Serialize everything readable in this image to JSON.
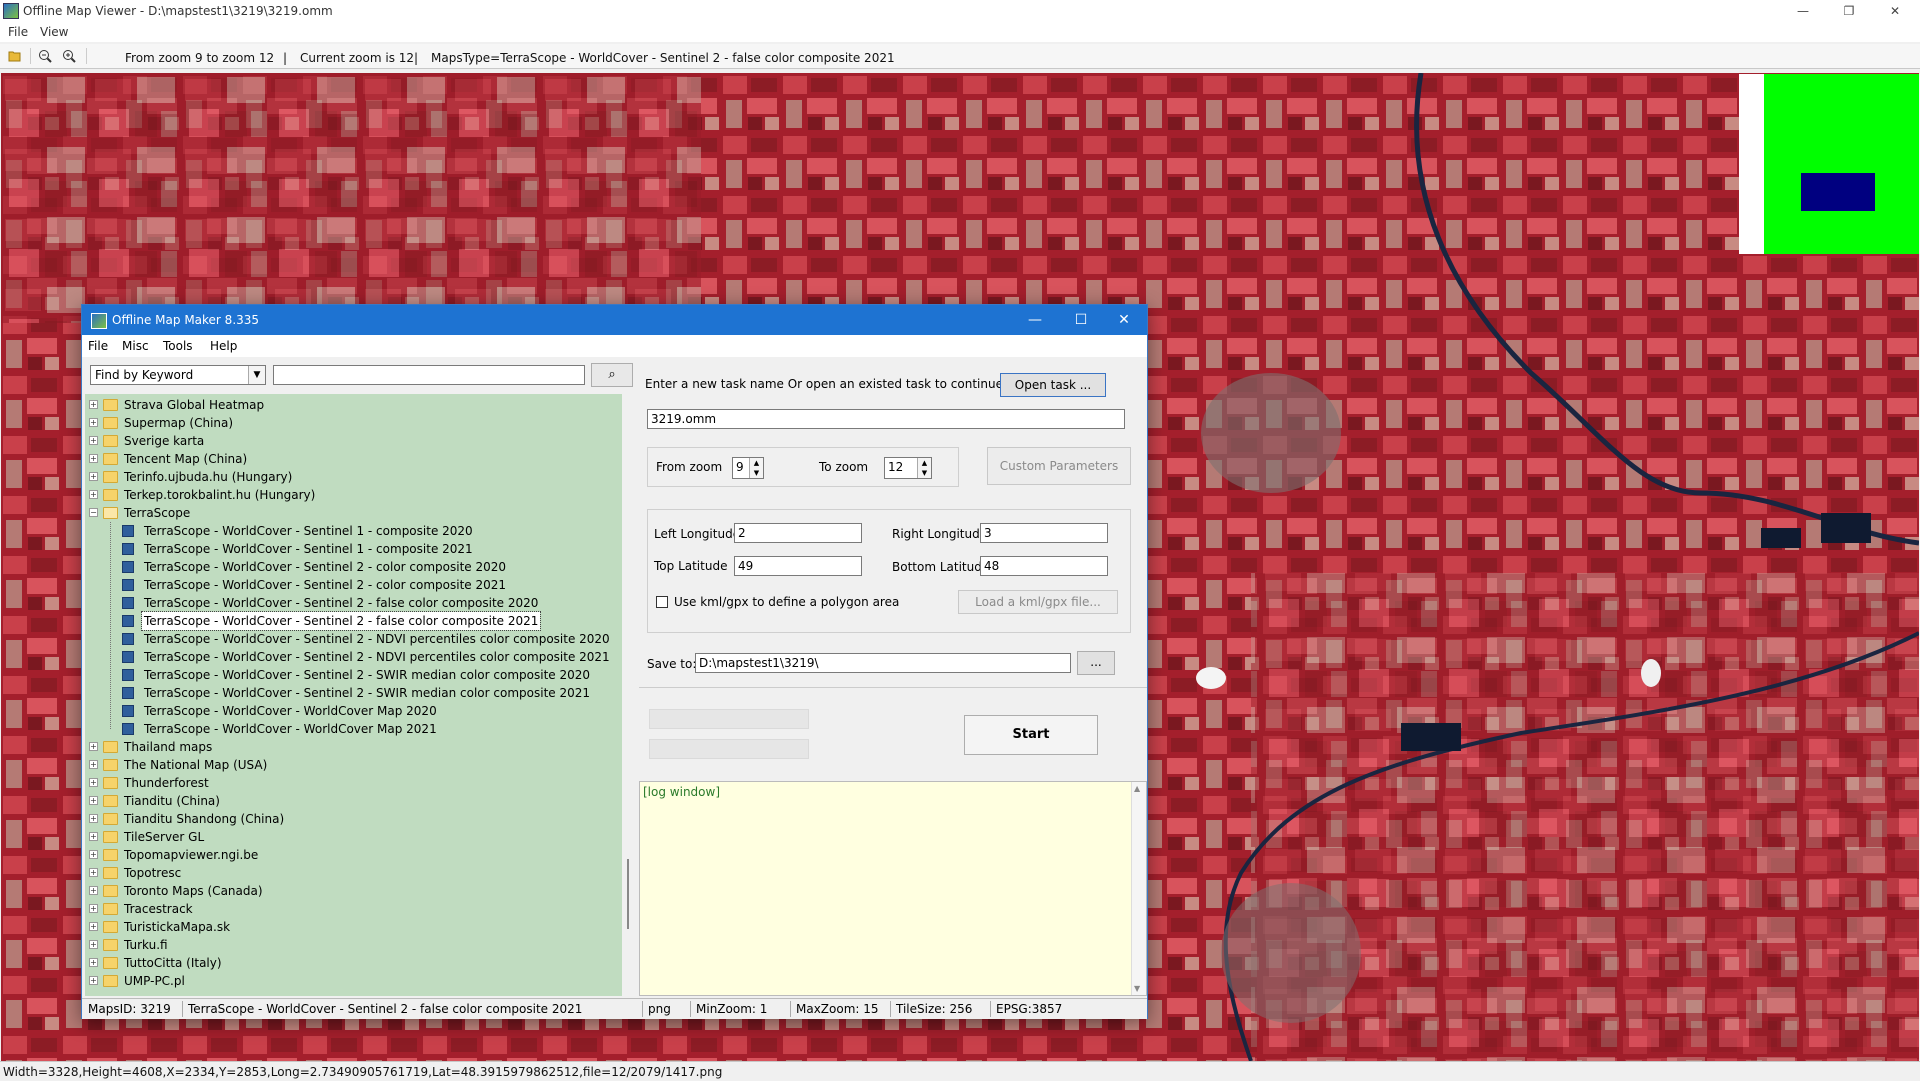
{
  "window": {
    "title": "Offline Map Viewer - D:\\mapstest1\\3219\\3219.omm",
    "controls": {
      "minimize": "—",
      "maximize": "❐",
      "close": "✕"
    }
  },
  "menu": [
    "File",
    "View"
  ],
  "toolbar": {
    "icons": [
      "open-folder-icon",
      "zoom-out-icon",
      "zoom-in-icon"
    ],
    "zoom_range": "From zoom 9 to zoom 12",
    "separator": "|",
    "current_zoom": "Current zoom is 12",
    "maps_type": "MapsType=TerraScope - WorldCover - Sentinel 2 - false color composite 2021"
  },
  "status_bar": "Width=3328,Height=4608,X=2334,Y=2853,Long=2.73490905761719,Lat=48.3915979862512,file=12/2079/1417.png",
  "minimap_colors": {
    "area": "#00ff00",
    "view": "#000080"
  },
  "dialog": {
    "title": "Offline Map Maker 8.335",
    "menu": [
      "File",
      "Misc",
      "Tools",
      "Help"
    ],
    "find_select": "Find by Keyword",
    "search_value": "",
    "tree": [
      {
        "label": "Strava Global Heatmap",
        "type": "folder",
        "expanded": false
      },
      {
        "label": "Supermap (China)",
        "type": "folder",
        "expanded": false
      },
      {
        "label": "Sverige karta",
        "type": "folder",
        "expanded": false
      },
      {
        "label": "Tencent Map (China)",
        "type": "folder",
        "expanded": false
      },
      {
        "label": "Terinfo.ujbuda.hu (Hungary)",
        "type": "folder",
        "expanded": false
      },
      {
        "label": "Terkep.torokbalint.hu (Hungary)",
        "type": "folder",
        "expanded": false
      },
      {
        "label": "TerraScope",
        "type": "folder",
        "expanded": true
      },
      {
        "label": "TerraScope - WorldCover - Sentinel 1 - composite 2020",
        "type": "map"
      },
      {
        "label": "TerraScope - WorldCover - Sentinel 1 - composite 2021",
        "type": "map"
      },
      {
        "label": "TerraScope - WorldCover - Sentinel 2 - color composite 2020",
        "type": "map"
      },
      {
        "label": "TerraScope - WorldCover - Sentinel 2 - color composite 2021",
        "type": "map"
      },
      {
        "label": "TerraScope - WorldCover - Sentinel 2 - false color composite 2020",
        "type": "map"
      },
      {
        "label": "TerraScope - WorldCover - Sentinel 2 - false color composite 2021",
        "type": "map",
        "selected": true
      },
      {
        "label": "TerraScope - WorldCover - Sentinel 2 - NDVI percentiles color composite 2020",
        "type": "map"
      },
      {
        "label": "TerraScope - WorldCover - Sentinel 2 - NDVI percentiles color composite 2021",
        "type": "map"
      },
      {
        "label": "TerraScope - WorldCover - Sentinel 2 - SWIR median color composite 2020",
        "type": "map"
      },
      {
        "label": "TerraScope - WorldCover - Sentinel 2 - SWIR median color composite 2021",
        "type": "map"
      },
      {
        "label": "TerraScope - WorldCover - WorldCover Map 2020",
        "type": "map"
      },
      {
        "label": "TerraScope - WorldCover - WorldCover Map 2021",
        "type": "map"
      },
      {
        "label": "Thailand maps",
        "type": "folder",
        "expanded": false
      },
      {
        "label": "The National Map (USA)",
        "type": "folder",
        "expanded": false
      },
      {
        "label": "Thunderforest",
        "type": "folder",
        "expanded": false
      },
      {
        "label": "Tianditu (China)",
        "type": "folder",
        "expanded": false
      },
      {
        "label": "Tianditu Shandong (China)",
        "type": "folder",
        "expanded": false
      },
      {
        "label": "TileServer GL",
        "type": "folder",
        "expanded": false
      },
      {
        "label": "Topomapviewer.ngi.be",
        "type": "folder",
        "expanded": false
      },
      {
        "label": "Topotresc",
        "type": "folder",
        "expanded": false
      },
      {
        "label": "Toronto Maps (Canada)",
        "type": "folder",
        "expanded": false
      },
      {
        "label": "Tracestrack",
        "type": "folder",
        "expanded": false
      },
      {
        "label": "TuristickaMapa.sk",
        "type": "folder",
        "expanded": false
      },
      {
        "label": "Turku.fi",
        "type": "folder",
        "expanded": false
      },
      {
        "label": "TuttoCitta (Italy)",
        "type": "folder",
        "expanded": false
      },
      {
        "label": "UMP-PC.pl",
        "type": "folder",
        "expanded": false
      }
    ],
    "task": {
      "prompt": "Enter a new task name Or open an existed task to continue:",
      "open_button": "Open task ...",
      "name": "3219.omm"
    },
    "zoom": {
      "from_label": "From zoom",
      "from_value": "9",
      "to_label": "To zoom",
      "to_value": "12",
      "custom_button": "Custom Parameters"
    },
    "bounds": {
      "left_label": "Left Longitude",
      "left_value": "2",
      "right_label": "Right Longitude",
      "right_value": "3",
      "top_label": "Top Latitude",
      "top_value": "49",
      "bottom_label": "Bottom Latitude",
      "bottom_value": "48",
      "kml_checkbox_label": "Use kml/gpx to define a polygon area",
      "kml_button": "Load a kml/gpx file..."
    },
    "save": {
      "label": "Save to:",
      "path": "D:\\mapstest1\\3219\\",
      "browse_button": "..."
    },
    "start_button": "Start",
    "log": "[log window]",
    "status": {
      "maps_id": "MapsID: 3219",
      "map_name": "TerraScope - WorldCover - Sentinel 2 - false color composite 2021",
      "format": "png",
      "min_zoom": "MinZoom: 1",
      "max_zoom": "MaxZoom: 15",
      "tile_size": "TileSize: 256",
      "epsg": "EPSG:3857"
    }
  }
}
